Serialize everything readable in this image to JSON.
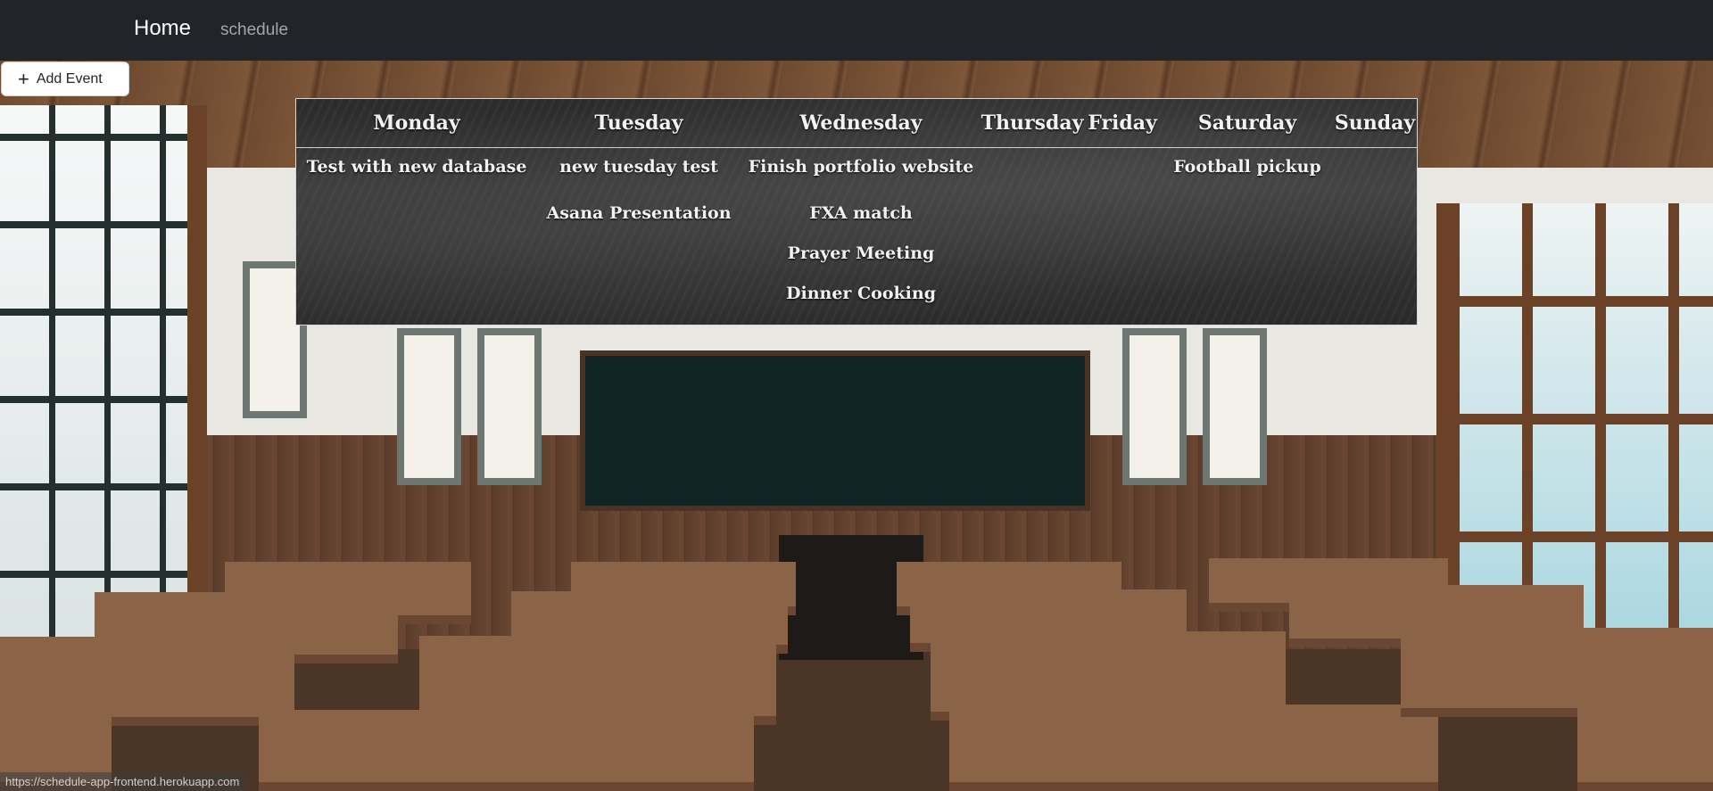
{
  "navbar": {
    "brand": "Home",
    "links": [
      {
        "label": "schedule"
      }
    ]
  },
  "toolbar": {
    "add_event_label": "Add Event",
    "add_event_icon": "plus-icon"
  },
  "schedule": {
    "days": [
      {
        "name": "Monday",
        "events": [
          "Test with new database"
        ]
      },
      {
        "name": "Tuesday",
        "events": [
          "new tuesday test",
          "Asana Presentation"
        ]
      },
      {
        "name": "Wednesday",
        "events": [
          "Finish portfolio website",
          "FXA match",
          "Prayer Meeting",
          "Dinner Cooking"
        ]
      },
      {
        "name": "Thursday",
        "events": []
      },
      {
        "name": "Friday",
        "events": []
      },
      {
        "name": "Saturday",
        "events": [
          "Football pickup"
        ]
      },
      {
        "name": "Sunday",
        "events": []
      }
    ]
  },
  "status_bar": {
    "url": "https://schedule-app-frontend.herokuapp.com"
  }
}
